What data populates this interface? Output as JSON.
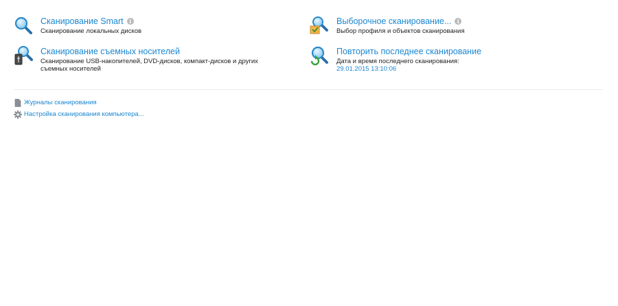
{
  "scan_actions": {
    "smart": {
      "title": "Сканирование Smart",
      "description": "Сканирование локальных дисков",
      "icon": "magnifier-icon"
    },
    "custom": {
      "title": "Выборочное сканирование...",
      "description": "Выбор профиля и объектов сканирования",
      "icon": "magnifier-checklist-icon"
    },
    "removable": {
      "title": "Сканирование съемных носителей",
      "description": "Сканирование USB-накопителей, DVD-дисков, компакт-дисков и других съемных носителей",
      "icon": "magnifier-usb-icon"
    },
    "repeat": {
      "title": "Повторить последнее сканирование",
      "description": "Дата и время последнего сканирования:",
      "last_scan": "29.01.2015 13:10:06",
      "icon": "magnifier-refresh-icon"
    }
  },
  "links": {
    "logs": "Журналы сканирования",
    "settings": "Настройка сканирования компьютера..."
  },
  "colors": {
    "link": "#1b87d1",
    "text": "#222222",
    "divider": "#ececec"
  }
}
